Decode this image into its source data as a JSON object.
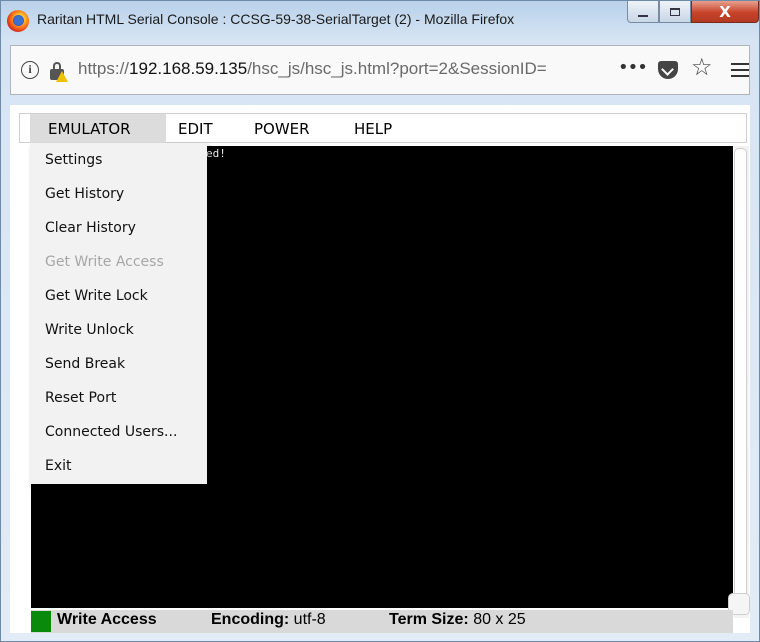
{
  "window": {
    "title": "Raritan HTML Serial Console : CCSG-59-38-SerialTarget (2) - Mozilla Firefox",
    "minimize_symbol": "",
    "maximize_symbol": "",
    "close_symbol": "X"
  },
  "urlbar": {
    "url_prefix": "https://",
    "url_host": "192.168.59.135",
    "url_path": "/hsc_js/hsc_js.html?port=2&SessionID=",
    "info_symbol": "i",
    "more_symbol": "•••",
    "star_symbol": "☆"
  },
  "menubar": {
    "items": [
      {
        "label": "EMULATOR",
        "active": true
      },
      {
        "label": "EDIT"
      },
      {
        "label": "POWER"
      },
      {
        "label": "HELP"
      }
    ]
  },
  "emulator_menu": {
    "items": [
      {
        "label": "Settings",
        "enabled": true
      },
      {
        "label": "Get History",
        "enabled": true
      },
      {
        "label": "Clear History",
        "enabled": true
      },
      {
        "label": "Get Write Access",
        "enabled": false
      },
      {
        "label": "Get Write Lock",
        "enabled": true
      },
      {
        "label": "Write Unlock",
        "enabled": true
      },
      {
        "label": "Send Break",
        "enabled": true
      },
      {
        "label": "Reset Port",
        "enabled": true
      },
      {
        "label": "Connected Users...",
        "enabled": true
      },
      {
        "label": "Exit",
        "enabled": true
      }
    ]
  },
  "terminal": {
    "visible_text": "ed!",
    "background": "#000000"
  },
  "statusbar": {
    "access": "Write Access",
    "encoding_label": "Encoding:",
    "encoding_value": "utf-8",
    "term_size_label": "Term Size:",
    "term_size_value": "80 x 25",
    "status_color": "#0a8a0a"
  },
  "icons": [
    "firefox-icon",
    "info-icon",
    "lock-warning-icon",
    "more-icon",
    "pocket-icon",
    "star-icon",
    "hamburger-icon",
    "minimize-icon",
    "maximize-icon",
    "close-icon"
  ]
}
